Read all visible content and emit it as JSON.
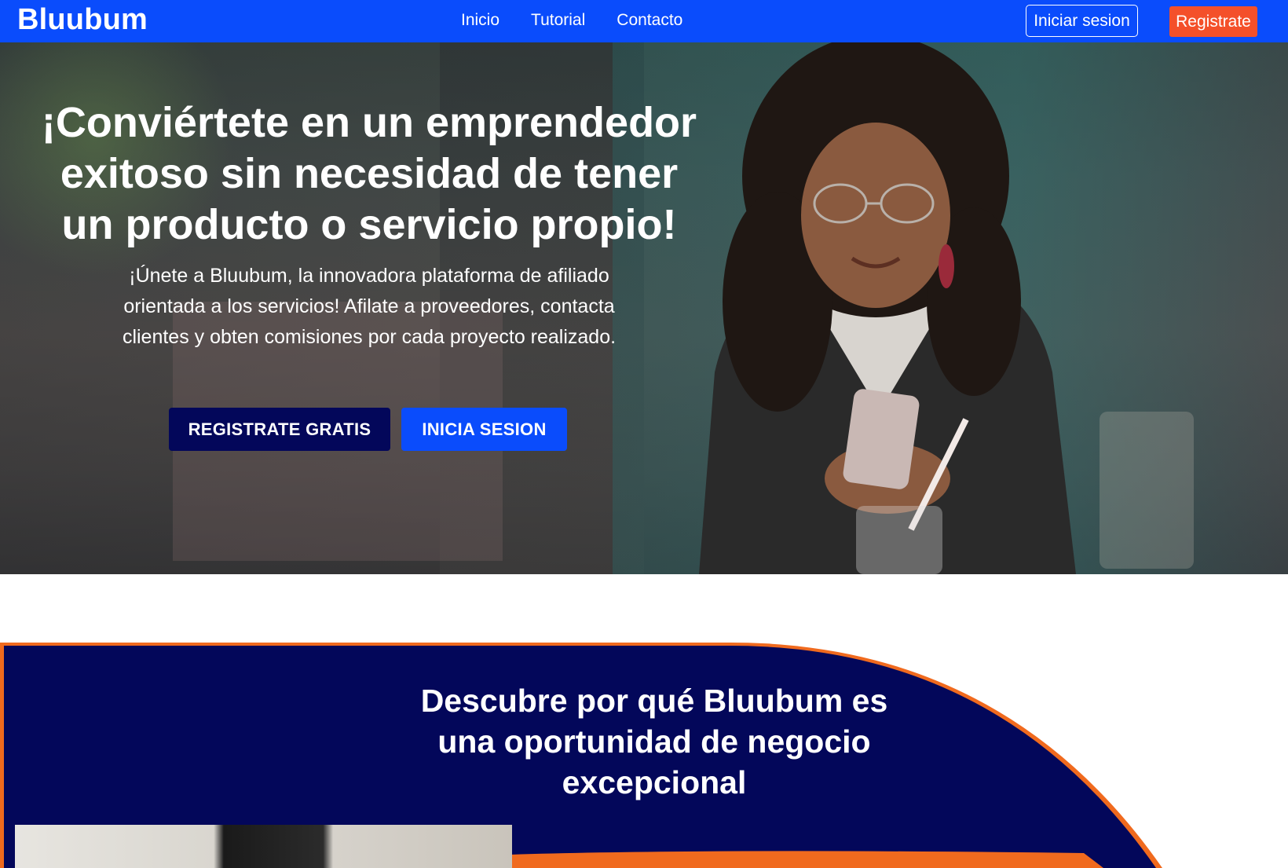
{
  "navbar": {
    "brand": "Bluubum",
    "links": [
      "Inicio",
      "Tutorial",
      "Contacto"
    ],
    "login_label": "Iniciar sesion",
    "register_label": "Registrate"
  },
  "hero": {
    "title": "¡Conviértete en un emprendedor exitoso sin necesidad de tener un producto o servicio propio!",
    "subtitle": "¡Únete a Bluubum, la innovadora plataforma de afiliado orientada a los servicios! Afilate a proveedores, contacta clientes y obten comisiones por cada proyecto realizado.",
    "primary_button": "REGISTRATE GRATIS",
    "secondary_button": "INICIA SESION"
  },
  "section2": {
    "title": "Descubre por qué Bluubum es una oportunidad de negocio excepcional"
  },
  "colors": {
    "nav_blue": "#0a4cfc",
    "accent_orange": "#f4502a",
    "navy": "#03075a"
  }
}
